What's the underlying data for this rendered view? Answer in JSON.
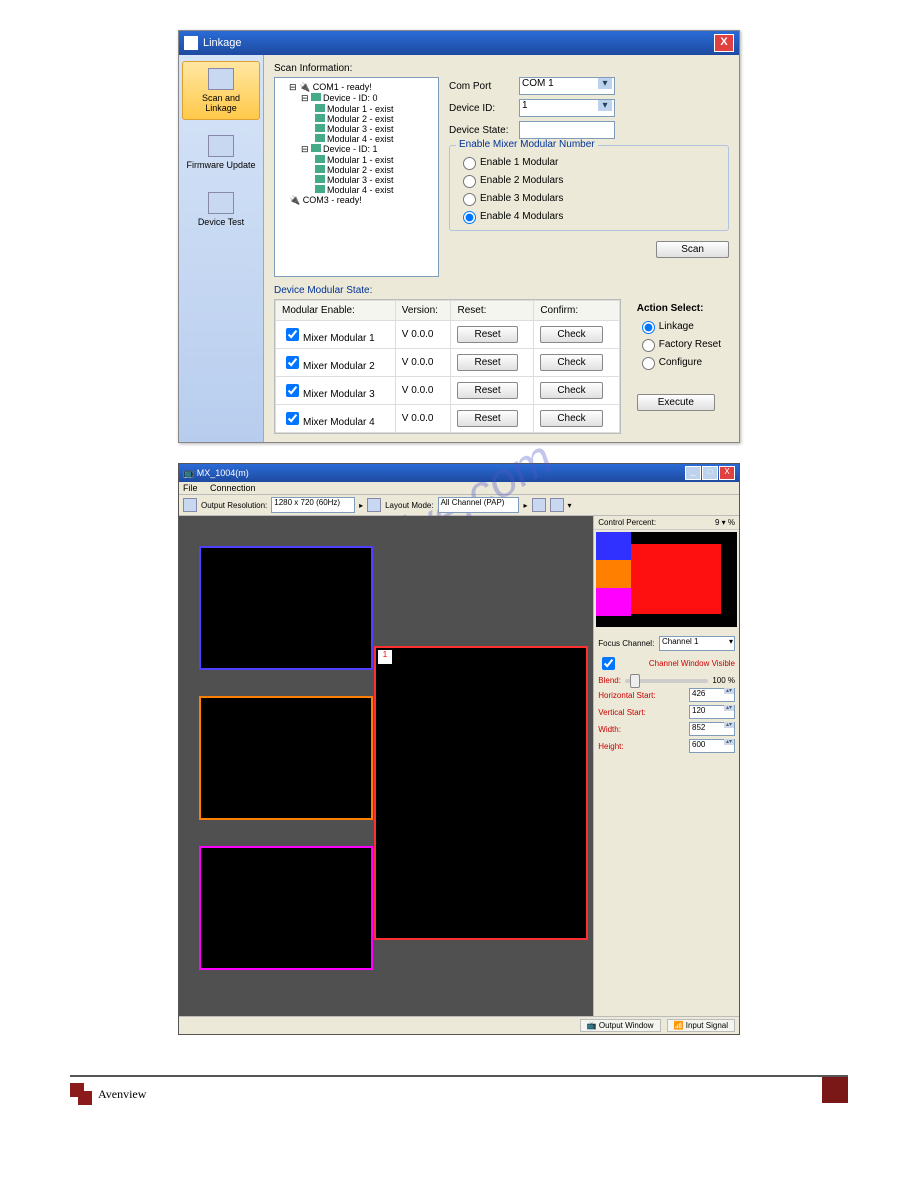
{
  "dlg1": {
    "title": "Linkage",
    "sidebar": [
      {
        "label": "Scan and Linkage",
        "active": true
      },
      {
        "label": "Firmware Update",
        "active": false
      },
      {
        "label": "Device Test",
        "active": false
      }
    ],
    "scan_info_label": "Scan Information:",
    "tree": {
      "com1": "COM1 - ready!",
      "dev0": "Device - ID: 0",
      "d0m1": "Modular 1 - exist",
      "d0m2": "Modular 2 - exist",
      "d0m3": "Modular 3 - exist",
      "d0m4": "Modular 4 - exist",
      "dev1": "Device - ID: 1",
      "d1m1": "Modular 1 - exist",
      "d1m2": "Modular 2 - exist",
      "d1m3": "Modular 3 - exist",
      "d1m4": "Modular 4 - exist",
      "com3": "COM3 - ready!"
    },
    "form": {
      "com_port_label": "Com Port",
      "com_port_value": "COM 1",
      "device_id_label": "Device ID:",
      "device_id_value": "1",
      "device_state_label": "Device State:",
      "device_state_value": ""
    },
    "enable_group": {
      "legend": "Enable Mixer Modular Number",
      "opt1": "Enable 1 Modular",
      "opt2": "Enable 2 Modulars",
      "opt3": "Enable 3 Modulars",
      "opt4": "Enable 4 Modulars"
    },
    "scan_btn": "Scan",
    "modular_state_label": "Device Modular State:",
    "table": {
      "h_enable": "Modular Enable:",
      "h_version": "Version:",
      "h_reset": "Reset:",
      "h_confirm": "Confirm:",
      "rows": [
        {
          "name": "Mixer Modular 1",
          "ver": "V 0.0.0"
        },
        {
          "name": "Mixer Modular 2",
          "ver": "V 0.0.0"
        },
        {
          "name": "Mixer Modular 3",
          "ver": "V 0.0.0"
        },
        {
          "name": "Mixer Modular 4",
          "ver": "V 0.0.0"
        }
      ],
      "reset_btn": "Reset",
      "check_btn": "Check"
    },
    "action": {
      "header": "Action Select:",
      "linkage": "Linkage",
      "factory": "Factory Reset",
      "configure": "Configure",
      "execute": "Execute"
    }
  },
  "dlg2": {
    "title": "MX_1004(m)",
    "menu": {
      "file": "File",
      "connection": "Connection"
    },
    "toolbar": {
      "out_res_label": "Output Resolution:",
      "out_res_value": "1280 x 720 (60Hz)",
      "layout_label": "Layout Mode:",
      "layout_value": "All Channel (PAP)"
    },
    "rpanel": {
      "preview_label": "Control Percent:",
      "preview_pct": "9",
      "focus_label": "Focus Channel:",
      "focus_value": "Channel 1",
      "visible_label": "Channel Window Visible",
      "blend_label": "Blend:",
      "blend_value": "100 %",
      "hstart_label": "Horizontal Start:",
      "hstart_value": "426",
      "vstart_label": "Vertical Start:",
      "vstart_value": "120",
      "width_label": "Width:",
      "width_value": "852",
      "height_label": "Height:",
      "height_value": "600"
    },
    "status": {
      "output": "Output Window",
      "input": "Input Signal"
    }
  },
  "footer": {
    "brand": "Avenview"
  }
}
